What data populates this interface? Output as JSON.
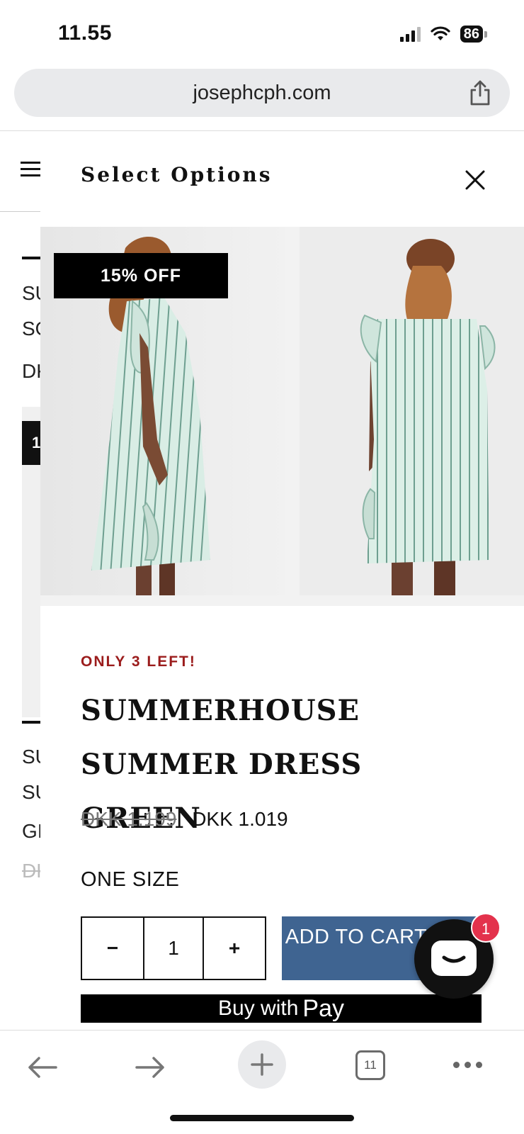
{
  "status_bar": {
    "time": "11.55",
    "battery": "86"
  },
  "browser": {
    "url": "josephcph.com",
    "tab_count": "11"
  },
  "background_page": {
    "block1": [
      "SU",
      "SO",
      "DK"
    ],
    "badge": "1",
    "block2": [
      "SU",
      "SU",
      "GI",
      "DK"
    ]
  },
  "modal": {
    "title": "Select Options",
    "badge": "15% OFF",
    "stock_note": "ONLY 3 LEFT!",
    "product_title": "SUMMERHOUSE SUMMER DRESS GREEN",
    "price_old": "DKK 1.199",
    "price_new": "DKK 1.019",
    "size": "ONE SIZE",
    "quantity": {
      "minus": "−",
      "value": "1",
      "plus": "+"
    },
    "add_to_cart": "ADD TO CART",
    "apple_pay": {
      "prefix": "Buy with",
      "glyph": "",
      "word": "Pay"
    }
  },
  "chat": {
    "unread": "1"
  },
  "colors": {
    "accent": "#3f6491",
    "stock_red": "#9b1c1c",
    "chat_badge": "#e3324c"
  },
  "icons": [
    "share-icon",
    "hamburger-icon",
    "close-icon",
    "chat-icon",
    "back-arrow-icon",
    "forward-arrow-icon",
    "plus-icon",
    "tabs-icon",
    "more-icon"
  ]
}
